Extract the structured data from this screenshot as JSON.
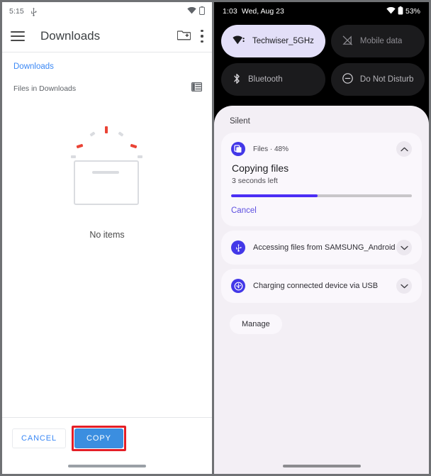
{
  "left_phone": {
    "status_bar": {
      "time": "5:15",
      "usb_icon": "usb-icon",
      "wifi_icon": "wifi-icon",
      "battery_icon": "battery-icon"
    },
    "app_bar": {
      "menu_icon": "hamburger-menu-icon",
      "title": "Downloads",
      "new_folder_icon": "new-folder-icon",
      "overflow_icon": "more-vertical-icon"
    },
    "breadcrumb": "Downloads",
    "sub_header": {
      "label": "Files in Downloads",
      "view_toggle_icon": "list-view-icon"
    },
    "empty_state": {
      "text": "No items",
      "illustration": "empty-box-burst-illustration",
      "box_color": "#dadce0",
      "accent_color": "#ea4335"
    },
    "footer": {
      "cancel_label": "CANCEL",
      "copy_label": "COPY",
      "copy_color": "#3b8ee0",
      "highlight_color": "#e41e26"
    }
  },
  "right_phone": {
    "status_bar": {
      "time": "1:03",
      "date": "Wed, Aug 23",
      "wifi_icon": "wifi-icon",
      "battery_icon": "battery-icon",
      "battery_percent": "53%"
    },
    "quick_settings": [
      {
        "label": "Techwiser_5GHz",
        "icon": "wifi-icon",
        "state": "on",
        "bg": "#e3dff8"
      },
      {
        "label": "Mobile data",
        "icon": "mobile-data-off-icon",
        "state": "off",
        "bg": "#1b1b1d"
      },
      {
        "label": "Bluetooth",
        "icon": "bluetooth-icon",
        "state": "off",
        "bg": "#1b1b1d"
      },
      {
        "label": "Do Not Disturb",
        "icon": "do-not-disturb-icon",
        "state": "off",
        "bg": "#1b1b1d"
      }
    ],
    "shade": {
      "section_title": "Silent",
      "manage_label": "Manage",
      "progress_notification": {
        "app_icon": "files-app-icon",
        "app_line": "Files · 48%",
        "title": "Copying files",
        "subtitle": "3 seconds left",
        "progress_percent": 48,
        "progress_color": "#4b2ef5",
        "action_label": "Cancel",
        "collapse_icon": "chevron-up-icon"
      },
      "notifications": [
        {
          "icon": "usb-accessing-icon",
          "label": "Accessing files from SAMSUNG_Android",
          "expand_icon": "chevron-down-icon"
        },
        {
          "icon": "usb-charging-icon",
          "label": "Charging connected device via USB",
          "expand_icon": "chevron-down-icon"
        }
      ]
    }
  }
}
